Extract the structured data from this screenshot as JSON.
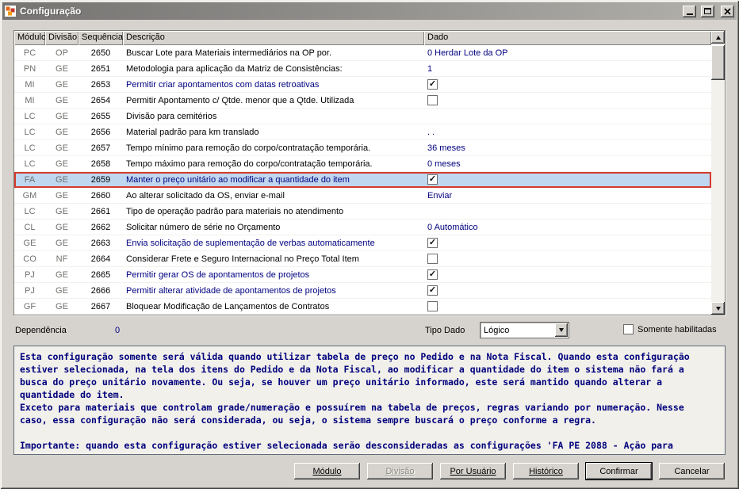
{
  "window": {
    "title": "Configuração"
  },
  "table": {
    "columns": [
      "Módulo",
      "Divisão",
      "Sequência",
      "Descrição",
      "Dado"
    ],
    "rows": [
      {
        "modulo": "PC",
        "divisao": "OP",
        "sequencia": "2650",
        "descricao": "Buscar Lote para Materiais intermediários na OP por.",
        "desc_blue": false,
        "selected": false,
        "dado": {
          "type": "text",
          "value": "0 Herdar Lote da OP"
        }
      },
      {
        "modulo": "PN",
        "divisao": "GE",
        "sequencia": "2651",
        "descricao": "Metodologia para aplicação da Matriz de Consistências:",
        "desc_blue": false,
        "selected": false,
        "dado": {
          "type": "text",
          "value": "1"
        }
      },
      {
        "modulo": "MI",
        "divisao": "GE",
        "sequencia": "2653",
        "descricao": "Permitir criar apontamentos com datas retroativas",
        "desc_blue": true,
        "selected": false,
        "dado": {
          "type": "checkbox",
          "checked": true
        }
      },
      {
        "modulo": "MI",
        "divisao": "GE",
        "sequencia": "2654",
        "descricao": "Permitir Apontamento c/ Qtde. menor que a Qtde. Utilizada",
        "desc_blue": false,
        "selected": false,
        "dado": {
          "type": "checkbox",
          "checked": false
        }
      },
      {
        "modulo": "LC",
        "divisao": "GE",
        "sequencia": "2655",
        "descricao": "Divisão para cemitérios",
        "desc_blue": false,
        "selected": false,
        "dado": {
          "type": "empty"
        }
      },
      {
        "modulo": "LC",
        "divisao": "GE",
        "sequencia": "2656",
        "descricao": "Material padrão para km translado",
        "desc_blue": false,
        "selected": false,
        "dado": {
          "type": "text",
          "value": ". ."
        }
      },
      {
        "modulo": "LC",
        "divisao": "GE",
        "sequencia": "2657",
        "descricao": "Tempo mínimo para remoção do corpo/contratação temporária.",
        "desc_blue": false,
        "selected": false,
        "dado": {
          "type": "text",
          "value": "36 meses"
        }
      },
      {
        "modulo": "LC",
        "divisao": "GE",
        "sequencia": "2658",
        "descricao": "Tempo máximo para remoção do corpo/contratação temporária.",
        "desc_blue": false,
        "selected": false,
        "dado": {
          "type": "text",
          "value": "0 meses"
        }
      },
      {
        "modulo": "FA",
        "divisao": "GE",
        "sequencia": "2659",
        "descricao": "Manter o preço unitário ao modificar a quantidade do item",
        "desc_blue": true,
        "selected": true,
        "dado": {
          "type": "checkbox",
          "checked": true
        }
      },
      {
        "modulo": "GM",
        "divisao": "GE",
        "sequencia": "2660",
        "descricao": "Ao alterar solicitado da OS, enviar e-mail",
        "desc_blue": false,
        "selected": false,
        "dado": {
          "type": "text",
          "value": "Enviar"
        }
      },
      {
        "modulo": "LC",
        "divisao": "GE",
        "sequencia": "2661",
        "descricao": "Tipo de operação padrão para materiais no atendimento",
        "desc_blue": false,
        "selected": false,
        "dado": {
          "type": "empty"
        }
      },
      {
        "modulo": "CL",
        "divisao": "GE",
        "sequencia": "2662",
        "descricao": "Solicitar número de série no Orçamento",
        "desc_blue": false,
        "selected": false,
        "dado": {
          "type": "text",
          "value": "0 Automático"
        }
      },
      {
        "modulo": "GE",
        "divisao": "GE",
        "sequencia": "2663",
        "descricao": "Envia solicitação de suplementação de verbas automaticamente",
        "desc_blue": true,
        "selected": false,
        "dado": {
          "type": "checkbox",
          "checked": true
        }
      },
      {
        "modulo": "CO",
        "divisao": "NF",
        "sequencia": "2664",
        "descricao": "Considerar Frete e Seguro Internacional no Preço Total Item",
        "desc_blue": false,
        "selected": false,
        "dado": {
          "type": "checkbox",
          "checked": false
        }
      },
      {
        "modulo": "PJ",
        "divisao": "GE",
        "sequencia": "2665",
        "descricao": "Permitir gerar OS de apontamentos de projetos",
        "desc_blue": true,
        "selected": false,
        "dado": {
          "type": "checkbox",
          "checked": true
        }
      },
      {
        "modulo": "PJ",
        "divisao": "GE",
        "sequencia": "2666",
        "descricao": "Permitir alterar atividade de apontamentos de projetos",
        "desc_blue": true,
        "selected": false,
        "dado": {
          "type": "checkbox",
          "checked": true
        }
      },
      {
        "modulo": "GF",
        "divisao": "GE",
        "sequencia": "2667",
        "descricao": "Bloquear Modificação de Lançamentos de Contratos",
        "desc_blue": false,
        "selected": false,
        "dado": {
          "type": "checkbox",
          "checked": false
        }
      }
    ]
  },
  "footer": {
    "dependencia_label": "Dependência",
    "dependencia_value": "0",
    "tipo_dado_label": "Tipo Dado",
    "tipo_dado_value": "Lógico",
    "somente_habilitadas_label": "Somente habilitadas",
    "somente_habilitadas_checked": false
  },
  "memo": {
    "text": "Esta configuração somente será válida quando utilizar tabela de preço no Pedido e na Nota Fiscal. Quando esta configuração\nestiver selecionada, na tela dos itens do Pedido e da Nota Fiscal, ao modificar a quantidade do item o sistema não fará a\nbusca do preço unitário novamente. Ou seja, se houver um preço unitário informado, este será mantido quando alterar a\nquantidade do item.\nExceto para materiais que controlam grade/numeração e possuírem na tabela de preços, regras variando por numeração. Nesse\ncaso, essa configuração não será considerada, ou seja, o sistema sempre buscará o preço conforme a regra.\n\nImportante: quando esta configuração estiver selecionada serão desconsideradas as configurações 'FA PE 2088 - Ação para"
  },
  "buttons": [
    {
      "label": "Módulo",
      "underline": true,
      "disabled": false,
      "default": false
    },
    {
      "label": "Divisão",
      "underline": true,
      "disabled": true,
      "default": false
    },
    {
      "label": "Por Usuário",
      "underline": true,
      "disabled": false,
      "default": false
    },
    {
      "label": "Histórico",
      "underline": true,
      "disabled": false,
      "default": false
    },
    {
      "label": "Confirmar",
      "underline": false,
      "disabled": false,
      "default": true
    },
    {
      "label": "Cancelar",
      "underline": false,
      "disabled": false,
      "default": false
    }
  ],
  "colors": {
    "value_text": "#000080",
    "selected_row_bg": "#bfd7ef",
    "selected_row_border": "#d43b2c",
    "dialog_bg": "#d6d3ce"
  }
}
